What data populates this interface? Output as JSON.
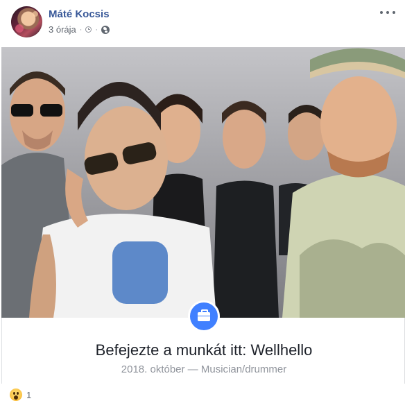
{
  "post": {
    "author_name": "Máté Kocsis",
    "time": "3 órája",
    "separator": "·"
  },
  "life_event": {
    "title": "Befejezte a munkát itt: Wellhello",
    "subtitle": "2018. október —  Musician/drummer"
  },
  "reactions": {
    "type": "wow",
    "count": "1"
  },
  "icons": {
    "menu": "more-dots-icon",
    "clock": "clock-icon",
    "audience": "globe-icon",
    "event": "briefcase-icon",
    "reaction": "wow-icon"
  },
  "colors": {
    "author_link": "#385898",
    "event_badge": "#4080ff",
    "meta_text": "#616770"
  }
}
